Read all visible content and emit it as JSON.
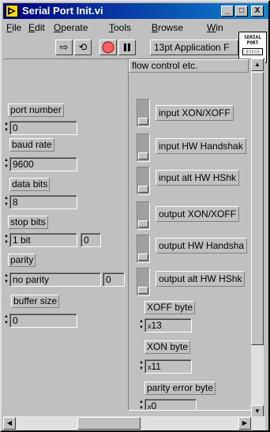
{
  "window": {
    "title": "Serial Port Init.vi",
    "minimize": "_",
    "maximize": "□",
    "close": "X"
  },
  "menu": [
    {
      "key": "F",
      "rest": "ile"
    },
    {
      "key": "E",
      "rest": "dit"
    },
    {
      "key": "O",
      "rest": "perate"
    },
    {
      "key": "T",
      "rest": "ools"
    },
    {
      "key": "B",
      "rest": "rowse"
    },
    {
      "key": "W",
      "rest": "in"
    }
  ],
  "connector": {
    "line1": "SERIAL",
    "line2": "PORT",
    "pins": "▯▯▯▯▯"
  },
  "toolbar": {
    "run": "⇨",
    "run_continuous": "⟲",
    "font": "13pt Application F"
  },
  "controls": {
    "port_number": {
      "label": "port number",
      "value": "0"
    },
    "baud_rate": {
      "label": "baud rate",
      "value": "9600"
    },
    "data_bits": {
      "label": "data bits",
      "value": "8"
    },
    "stop_bits": {
      "label": "stop bits",
      "value": "1 bit",
      "index": "0"
    },
    "parity": {
      "label": "parity",
      "value": "no parity",
      "index": "0"
    },
    "buffer_size": {
      "label": "buffer size",
      "value": "0"
    }
  },
  "flow_control": {
    "title": "flow control etc.",
    "switches": [
      {
        "label": "input XON/XOFF"
      },
      {
        "label": "input HW Handshak"
      },
      {
        "label": "input alt HW HShk"
      },
      {
        "label": "output XON/XOFF"
      },
      {
        "label": "output HW Handsha"
      },
      {
        "label": "output alt HW HShk"
      }
    ],
    "xoff_byte": {
      "label": "XOFF byte",
      "radix": "x",
      "value": "13"
    },
    "xon_byte": {
      "label": "XON byte",
      "radix": "x",
      "value": "11"
    },
    "parity_error_byte": {
      "label": "parity error byte",
      "radix": "x",
      "value": "0"
    }
  },
  "scroll": {
    "up": "▲",
    "down": "▼",
    "left": "◀",
    "right": "▶"
  },
  "colors": {
    "titlebar": "#000080",
    "face": "#c0c0c0",
    "stop": "#ff6060"
  }
}
